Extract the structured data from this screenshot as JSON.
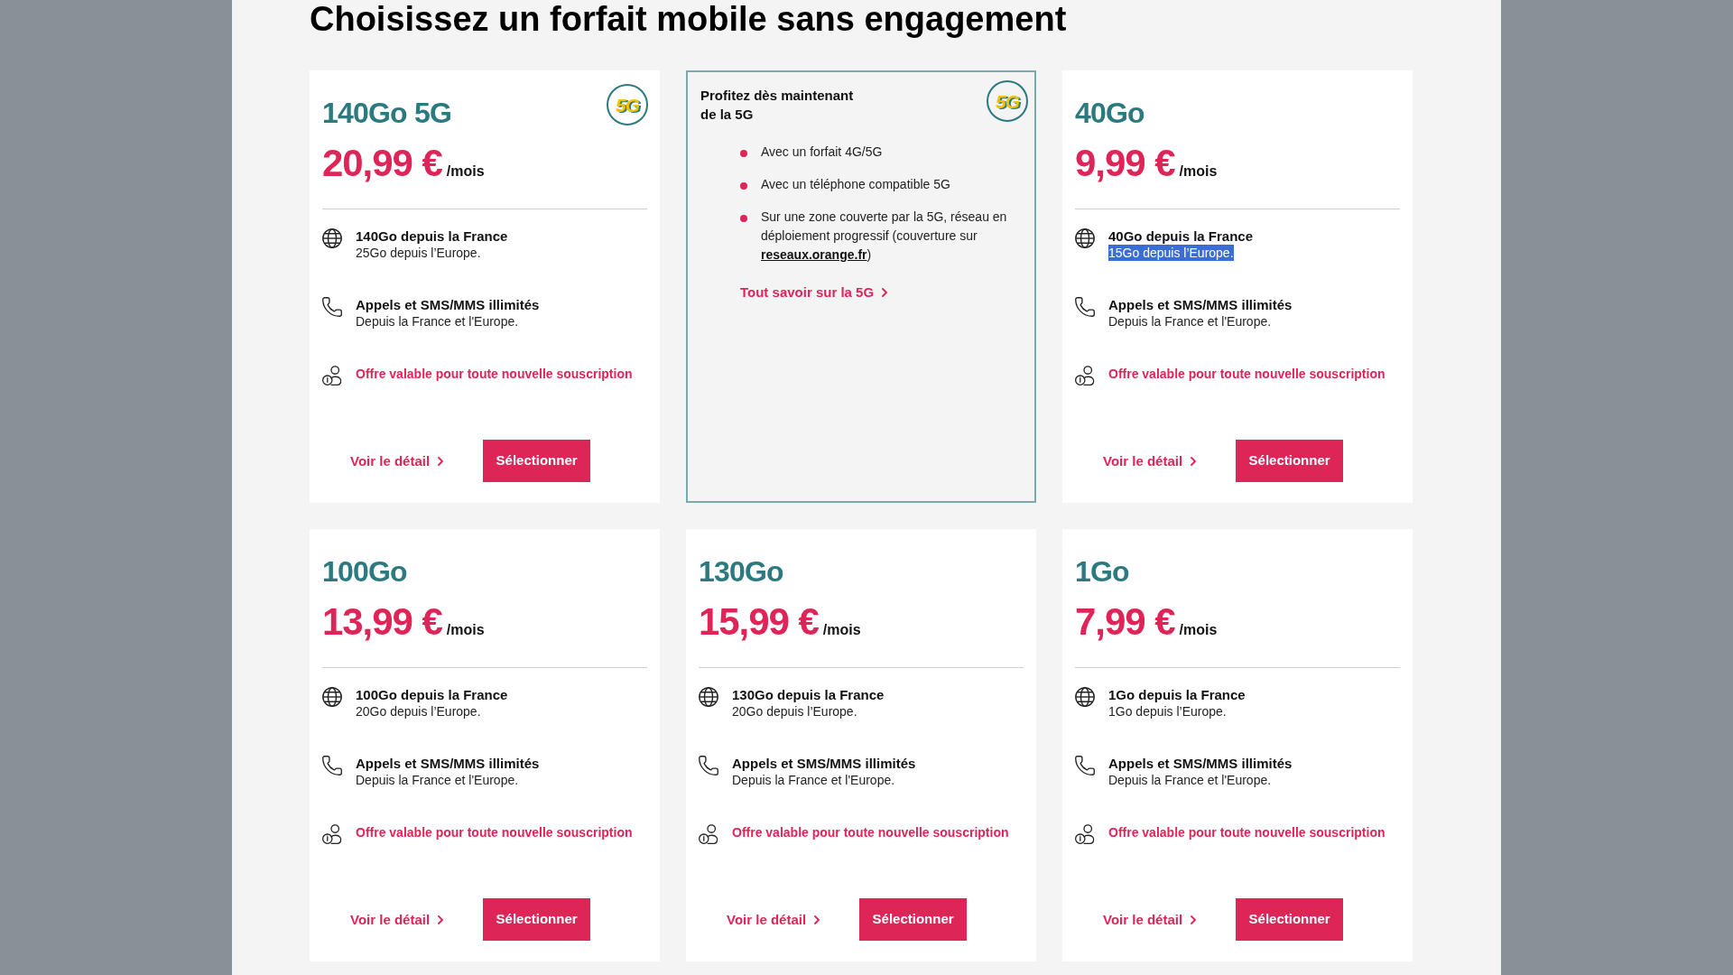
{
  "page": {
    "title": "Choisissez un forfait mobile sans engagement"
  },
  "cards": [
    {
      "kind": "plan",
      "name": "140Go 5G",
      "badge": "5G",
      "price": "20,99 €",
      "period": "/mois",
      "features": [
        {
          "kind": "data",
          "title": "140Go depuis la France",
          "detail": "25Go depuis l’Europe.",
          "highlighted": false
        },
        {
          "kind": "calls",
          "title": "Appels et SMS/MMS illimités",
          "detail": "Depuis la France et l'Europe.",
          "highlighted": false
        },
        {
          "kind": "offer",
          "title": "Offre valable pour toute nouvelle souscription"
        }
      ],
      "detail_link": "Voir le détail",
      "select_button": "Sélectionner"
    },
    {
      "kind": "promo",
      "heading": "Profitez dès maintenant de la 5G",
      "badge": "5G",
      "bullets": [
        {
          "text": "Avec un forfait 4G/5G"
        },
        {
          "text": "Avec un téléphone compatible 5G"
        },
        {
          "text": "Sur une zone couverte par la 5G, réseau en déploiement progressif (couverture sur",
          "link": "reseaux.orange.fr",
          "text_after": ")"
        }
      ],
      "more_link": "Tout savoir sur la 5G"
    },
    {
      "kind": "plan",
      "name": "40Go",
      "price": "9,99 €",
      "period": "/mois",
      "features": [
        {
          "kind": "data",
          "title": "40Go depuis la France",
          "detail": "15Go depuis l’Europe.",
          "highlighted": true
        },
        {
          "kind": "calls",
          "title": "Appels et SMS/MMS illimités",
          "detail": "Depuis la France et l'Europe.",
          "highlighted": false
        },
        {
          "kind": "offer",
          "title": "Offre valable pour toute nouvelle souscription"
        }
      ],
      "detail_link": "Voir le détail",
      "select_button": "Sélectionner"
    },
    {
      "kind": "plan",
      "name": "100Go",
      "price": "13,99 €",
      "period": "/mois",
      "features": [
        {
          "kind": "data",
          "title": "100Go depuis la France",
          "detail": "20Go depuis l’Europe.",
          "highlighted": false
        },
        {
          "kind": "calls",
          "title": "Appels et SMS/MMS illimités",
          "detail": "Depuis la France et l'Europe.",
          "highlighted": false
        },
        {
          "kind": "offer",
          "title": "Offre valable pour toute nouvelle souscription"
        }
      ],
      "detail_link": "Voir le détail",
      "select_button": "Sélectionner"
    },
    {
      "kind": "plan",
      "name": "130Go",
      "price": "15,99 €",
      "period": "/mois",
      "features": [
        {
          "kind": "data",
          "title": "130Go depuis la France",
          "detail": "20Go depuis l’Europe.",
          "highlighted": false
        },
        {
          "kind": "calls",
          "title": "Appels et SMS/MMS illimités",
          "detail": "Depuis la France et l'Europe.",
          "highlighted": false
        },
        {
          "kind": "offer",
          "title": "Offre valable pour toute nouvelle souscription"
        }
      ],
      "detail_link": "Voir le détail",
      "select_button": "Sélectionner"
    },
    {
      "kind": "plan",
      "name": "1Go",
      "price": "7,99 €",
      "period": "/mois",
      "features": [
        {
          "kind": "data",
          "title": "1Go depuis la France",
          "detail": "1Go depuis l’Europe.",
          "highlighted": false
        },
        {
          "kind": "calls",
          "title": "Appels et SMS/MMS illimités",
          "detail": "Depuis la France et l'Europe.",
          "highlighted": false
        },
        {
          "kind": "offer",
          "title": "Offre valable pour toute nouvelle souscription"
        }
      ],
      "detail_link": "Voir le détail",
      "select_button": "Sélectionner"
    }
  ]
}
